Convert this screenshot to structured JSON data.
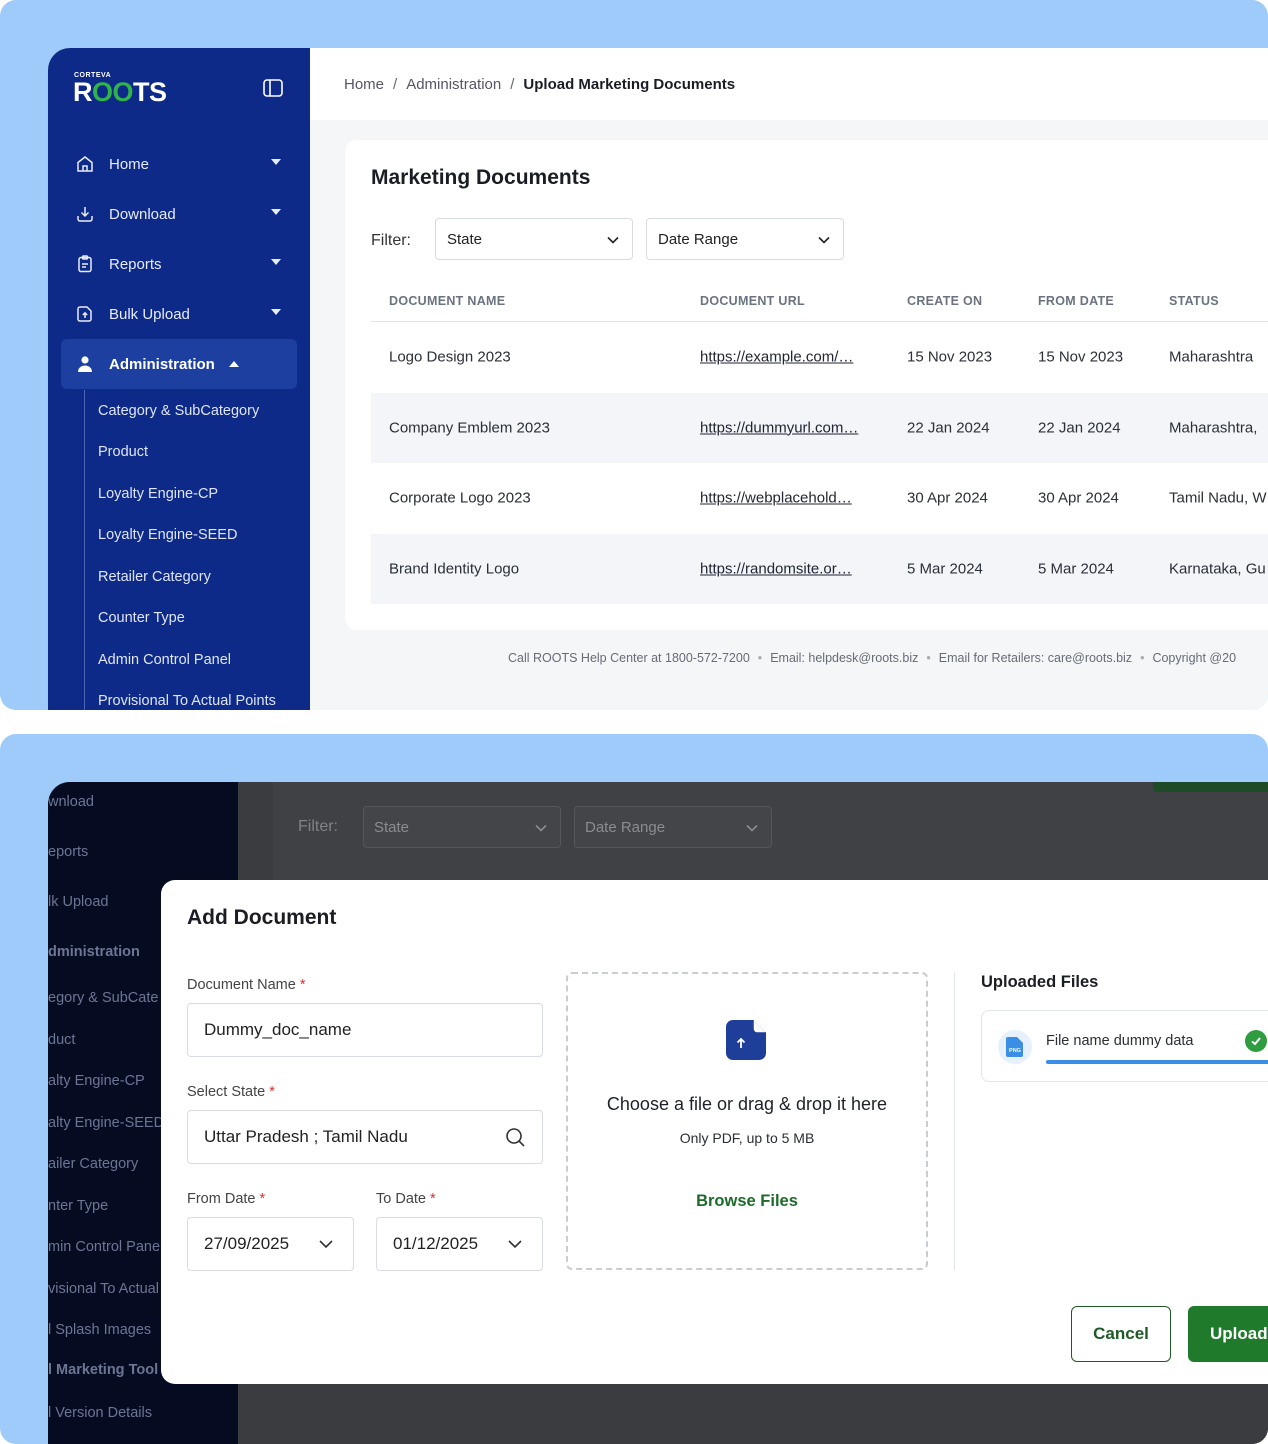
{
  "brand": {
    "small": "CORTEVA",
    "name_prefix": "R",
    "name_oo": "OO",
    "name_suffix": "TS"
  },
  "sidebar": {
    "items": [
      {
        "label": "Home",
        "icon": "home-icon"
      },
      {
        "label": "Download",
        "icon": "download-icon"
      },
      {
        "label": "Reports",
        "icon": "clipboard-icon"
      },
      {
        "label": "Bulk Upload",
        "icon": "upload-icon"
      },
      {
        "label": "Administration",
        "icon": "user-icon"
      }
    ],
    "sub_items": [
      "Category & SubCategory",
      "Product",
      "Loyalty Engine-CP",
      "Loyalty Engine-SEED",
      "Retailer Category",
      "Counter Type",
      "Admin Control Panel",
      "Provisional To Actual Points"
    ]
  },
  "breadcrumb": {
    "home": "Home",
    "section": "Administration",
    "current": "Upload Marketing Documents",
    "separator": "/"
  },
  "documents": {
    "title": "Marketing Documents",
    "filter_label": "Filter:",
    "filter_state": "State",
    "filter_date": "Date Range",
    "columns": [
      "DOCUMENT NAME",
      "DOCUMENT URL",
      "CREATE ON",
      "FROM DATE",
      "STATUS"
    ],
    "rows": [
      {
        "name": "Logo Design 2023",
        "url": "https://example.com/…",
        "created": "15 Nov 2023",
        "from": "15 Nov 2023",
        "status": "Maharashtra"
      },
      {
        "name": "Company Emblem 2023",
        "url": "https://dummyurl.com…",
        "created": "22 Jan 2024",
        "from": "22 Jan 2024",
        "status": "Maharashtra,"
      },
      {
        "name": "Corporate Logo 2023",
        "url": "https://webplacehold…",
        "created": "30 Apr 2024",
        "from": "30 Apr 2024",
        "status": "Tamil Nadu, W"
      },
      {
        "name": "Brand Identity Logo",
        "url": "https://randomsite.or…",
        "created": "5 Mar 2024",
        "from": "5 Mar 2024",
        "status": "Karnataka, Gu"
      }
    ]
  },
  "footer": {
    "help": "Call ROOTS Help Center at 1800-572-7200",
    "email": "Email: helpdesk@roots.biz",
    "retailers": "Email for Retailers: care@roots.biz",
    "copyright": "Copyright @20"
  },
  "background_sidebar": {
    "items": [
      "wnload",
      "eports",
      "lk Upload",
      "dministration",
      "egory & SubCate",
      "duct",
      "alty Engine-CP",
      "alty Engine-SEED",
      "ailer Category",
      "nter Type",
      "min Control Panel",
      "visional To Actual",
      "l Splash Images",
      "l Marketing Tool",
      "l Version Details"
    ]
  },
  "modal": {
    "title": "Add Document",
    "doc_name_label": "Document Name",
    "doc_name_value": "Dummy_doc_name",
    "state_label": "Select State",
    "state_value": "Uttar Pradesh ; Tamil Nadu",
    "from_label": "From Date",
    "from_value": "27/09/2025",
    "to_label": "To Date",
    "to_value": "01/12/2025",
    "required_mark": "*",
    "dropzone_title": "Choose a file or drag & drop it here",
    "dropzone_sub": "Only PDF, up to 5 MB",
    "browse_label": "Browse Files",
    "uploaded_title": "Uploaded Files",
    "file_name": "File name dummy data",
    "file_type": "PNG",
    "file_progress": 1.0,
    "cancel_label": "Cancel",
    "upload_label": "Upload"
  },
  "colors": {
    "sidebar": "#0d2a88",
    "accent_green": "#1f7a2b",
    "progress_blue": "#3a8ee6",
    "panel_bg": "#9ecbf9"
  }
}
